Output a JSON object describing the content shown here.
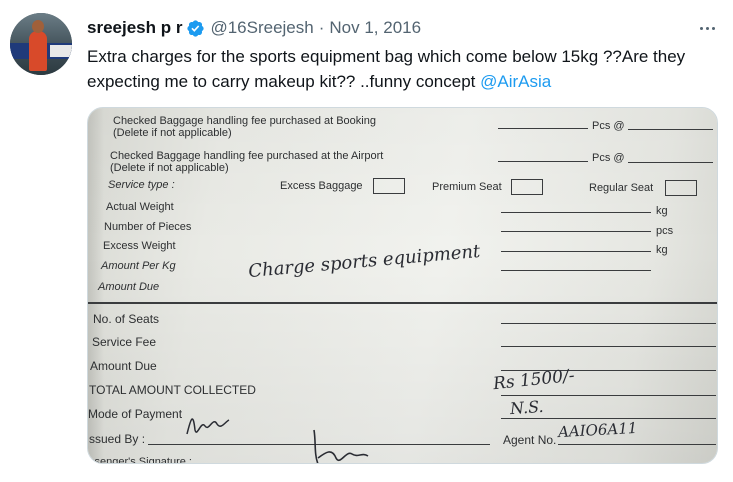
{
  "tweet": {
    "display_name": "sreejesh p r",
    "handle": "@16Sreejesh",
    "separator": "·",
    "date": "Nov 1, 2016",
    "text_part1": "Extra charges for the sports equipment bag which come below 15kg ??Are they expecting me to carry makeup kit?? ..funny concept ",
    "mention": "@AirAsia",
    "icons": {
      "verified": "verified-badge-icon",
      "more": "more-options-icon"
    },
    "colors": {
      "link": "#1d9bf0",
      "secondary": "#536471",
      "verified": "#1d9bf0"
    }
  },
  "receipt": {
    "line1a": "Checked Baggage handling fee purchased at Booking",
    "line1b": "(Delete if not applicable)",
    "line2a": "Checked Baggage handling fee purchased at the Airport",
    "line2b": "(Delete if not applicable)",
    "pcs1": "Pcs @",
    "pcs2": "Pcs @",
    "service_type": "Service type :",
    "excess_baggage": "Excess Baggage",
    "premium_seat": "Premium Seat",
    "regular_seat": "Regular Seat",
    "actual_weight": "Actual Weight",
    "number_of_pieces": "Number of Pieces",
    "excess_weight": "Excess Weight",
    "amount_per_kg": "Amount Per Kg",
    "amount_due": "Amount Due",
    "unit_kg1": "kg",
    "unit_pcs": "pcs",
    "unit_kg2": "kg",
    "no_of_seats": "No. of Seats",
    "service_fee": "Service Fee",
    "amount_due2": "Amount Due",
    "total_amount": "TOTAL AMOUNT COLLECTED",
    "mode_of_payment": "Mode of Payment",
    "issued_by": "ssued By :",
    "agent_no": "Agent No.",
    "passenger_signature": "ssenger's Signature :",
    "handwritten_note": "Charge sports equipment",
    "handwritten_amount": "Rs 1500/-",
    "handwritten_payment": "N.S.",
    "handwritten_agent": "AAIO6A11"
  }
}
